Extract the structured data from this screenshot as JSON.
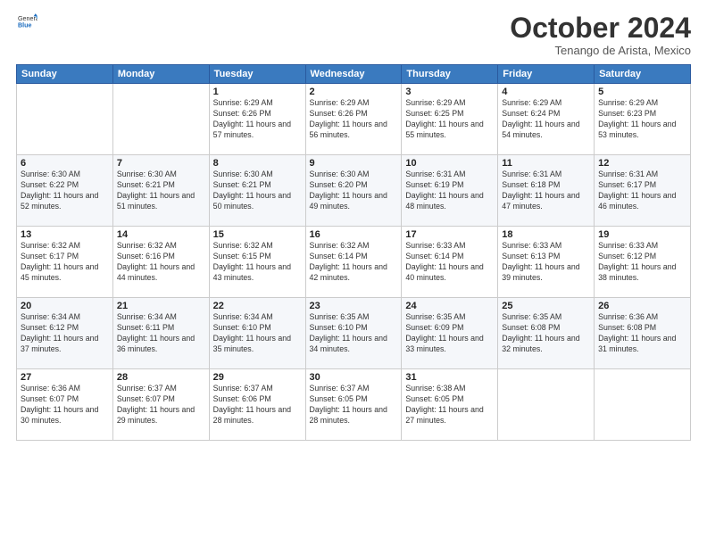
{
  "logo": {
    "line1": "General",
    "line2": "Blue"
  },
  "header": {
    "month": "October 2024",
    "location": "Tenango de Arista, Mexico"
  },
  "weekdays": [
    "Sunday",
    "Monday",
    "Tuesday",
    "Wednesday",
    "Thursday",
    "Friday",
    "Saturday"
  ],
  "weeks": [
    [
      {
        "day": "",
        "info": ""
      },
      {
        "day": "",
        "info": ""
      },
      {
        "day": "1",
        "info": "Sunrise: 6:29 AM\nSunset: 6:26 PM\nDaylight: 11 hours and 57 minutes."
      },
      {
        "day": "2",
        "info": "Sunrise: 6:29 AM\nSunset: 6:26 PM\nDaylight: 11 hours and 56 minutes."
      },
      {
        "day": "3",
        "info": "Sunrise: 6:29 AM\nSunset: 6:25 PM\nDaylight: 11 hours and 55 minutes."
      },
      {
        "day": "4",
        "info": "Sunrise: 6:29 AM\nSunset: 6:24 PM\nDaylight: 11 hours and 54 minutes."
      },
      {
        "day": "5",
        "info": "Sunrise: 6:29 AM\nSunset: 6:23 PM\nDaylight: 11 hours and 53 minutes."
      }
    ],
    [
      {
        "day": "6",
        "info": "Sunrise: 6:30 AM\nSunset: 6:22 PM\nDaylight: 11 hours and 52 minutes."
      },
      {
        "day": "7",
        "info": "Sunrise: 6:30 AM\nSunset: 6:21 PM\nDaylight: 11 hours and 51 minutes."
      },
      {
        "day": "8",
        "info": "Sunrise: 6:30 AM\nSunset: 6:21 PM\nDaylight: 11 hours and 50 minutes."
      },
      {
        "day": "9",
        "info": "Sunrise: 6:30 AM\nSunset: 6:20 PM\nDaylight: 11 hours and 49 minutes."
      },
      {
        "day": "10",
        "info": "Sunrise: 6:31 AM\nSunset: 6:19 PM\nDaylight: 11 hours and 48 minutes."
      },
      {
        "day": "11",
        "info": "Sunrise: 6:31 AM\nSunset: 6:18 PM\nDaylight: 11 hours and 47 minutes."
      },
      {
        "day": "12",
        "info": "Sunrise: 6:31 AM\nSunset: 6:17 PM\nDaylight: 11 hours and 46 minutes."
      }
    ],
    [
      {
        "day": "13",
        "info": "Sunrise: 6:32 AM\nSunset: 6:17 PM\nDaylight: 11 hours and 45 minutes."
      },
      {
        "day": "14",
        "info": "Sunrise: 6:32 AM\nSunset: 6:16 PM\nDaylight: 11 hours and 44 minutes."
      },
      {
        "day": "15",
        "info": "Sunrise: 6:32 AM\nSunset: 6:15 PM\nDaylight: 11 hours and 43 minutes."
      },
      {
        "day": "16",
        "info": "Sunrise: 6:32 AM\nSunset: 6:14 PM\nDaylight: 11 hours and 42 minutes."
      },
      {
        "day": "17",
        "info": "Sunrise: 6:33 AM\nSunset: 6:14 PM\nDaylight: 11 hours and 40 minutes."
      },
      {
        "day": "18",
        "info": "Sunrise: 6:33 AM\nSunset: 6:13 PM\nDaylight: 11 hours and 39 minutes."
      },
      {
        "day": "19",
        "info": "Sunrise: 6:33 AM\nSunset: 6:12 PM\nDaylight: 11 hours and 38 minutes."
      }
    ],
    [
      {
        "day": "20",
        "info": "Sunrise: 6:34 AM\nSunset: 6:12 PM\nDaylight: 11 hours and 37 minutes."
      },
      {
        "day": "21",
        "info": "Sunrise: 6:34 AM\nSunset: 6:11 PM\nDaylight: 11 hours and 36 minutes."
      },
      {
        "day": "22",
        "info": "Sunrise: 6:34 AM\nSunset: 6:10 PM\nDaylight: 11 hours and 35 minutes."
      },
      {
        "day": "23",
        "info": "Sunrise: 6:35 AM\nSunset: 6:10 PM\nDaylight: 11 hours and 34 minutes."
      },
      {
        "day": "24",
        "info": "Sunrise: 6:35 AM\nSunset: 6:09 PM\nDaylight: 11 hours and 33 minutes."
      },
      {
        "day": "25",
        "info": "Sunrise: 6:35 AM\nSunset: 6:08 PM\nDaylight: 11 hours and 32 minutes."
      },
      {
        "day": "26",
        "info": "Sunrise: 6:36 AM\nSunset: 6:08 PM\nDaylight: 11 hours and 31 minutes."
      }
    ],
    [
      {
        "day": "27",
        "info": "Sunrise: 6:36 AM\nSunset: 6:07 PM\nDaylight: 11 hours and 30 minutes."
      },
      {
        "day": "28",
        "info": "Sunrise: 6:37 AM\nSunset: 6:07 PM\nDaylight: 11 hours and 29 minutes."
      },
      {
        "day": "29",
        "info": "Sunrise: 6:37 AM\nSunset: 6:06 PM\nDaylight: 11 hours and 28 minutes."
      },
      {
        "day": "30",
        "info": "Sunrise: 6:37 AM\nSunset: 6:05 PM\nDaylight: 11 hours and 28 minutes."
      },
      {
        "day": "31",
        "info": "Sunrise: 6:38 AM\nSunset: 6:05 PM\nDaylight: 11 hours and 27 minutes."
      },
      {
        "day": "",
        "info": ""
      },
      {
        "day": "",
        "info": ""
      }
    ]
  ]
}
